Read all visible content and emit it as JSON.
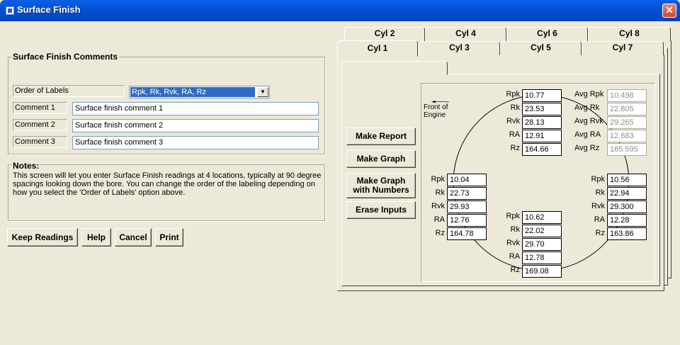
{
  "window": {
    "title": "Surface Finish",
    "close_glyph": "✕"
  },
  "comments": {
    "legend": "Surface Finish Comments",
    "order_label": "Order of Labels",
    "order_value": "Rpk, Rk, Rvk, RA, Rz",
    "rows": [
      {
        "label": "Comment 1",
        "value": "Surface finish comment 1"
      },
      {
        "label": "Comment 2",
        "value": "Surface finish comment 2"
      },
      {
        "label": "Comment 3",
        "value": "Surface finish comment 3"
      }
    ]
  },
  "notes": {
    "legend": "Notes:",
    "text": "This screen will let you enter Surface Finish readings at 4 locations, typically at 90 degree spacings looking down the bore.  You can change the order of the labeling depending on how you select the 'Order of Labels' option above."
  },
  "buttons": {
    "keep": "Keep Readings",
    "help": "Help",
    "cancel": "Cancel",
    "print": "Print"
  },
  "tabs": {
    "back": [
      "Cyl 2",
      "Cyl 4",
      "Cyl 6",
      "Cyl 8"
    ],
    "front": [
      "Cyl 1",
      "Cyl 3",
      "Cyl 5",
      "Cyl 7"
    ],
    "selected": "Cyl 1"
  },
  "actions": {
    "report": "Make Report",
    "graph": "Make Graph",
    "graph_numbers": "Make Graph with Numbers",
    "erase": "Erase Inputs"
  },
  "diagram": {
    "front_label": "Front of Engine",
    "arrow_glyph": "←",
    "labels": [
      "Rpk",
      "Rk",
      "Rvk",
      "RA",
      "Rz"
    ],
    "top": [
      "10.77",
      "23.53",
      "28.13",
      "12.91",
      "164.66"
    ],
    "left": [
      "10.04",
      "22.73",
      "29.93",
      "12.76",
      "164.78"
    ],
    "right": [
      "10.56",
      "22.94",
      "29.300",
      "12.28",
      "163.86"
    ],
    "bottom": [
      "10.62",
      "22.02",
      "29.70",
      "12.78",
      "169.08"
    ],
    "avg_labels": [
      "Avg Rpk",
      "Avg Rk",
      "Avg Rvk",
      "Avg RA",
      "Avg Rz"
    ],
    "avg": [
      "10.498",
      "22.805",
      "29.265",
      "12.683",
      "165.595"
    ]
  }
}
